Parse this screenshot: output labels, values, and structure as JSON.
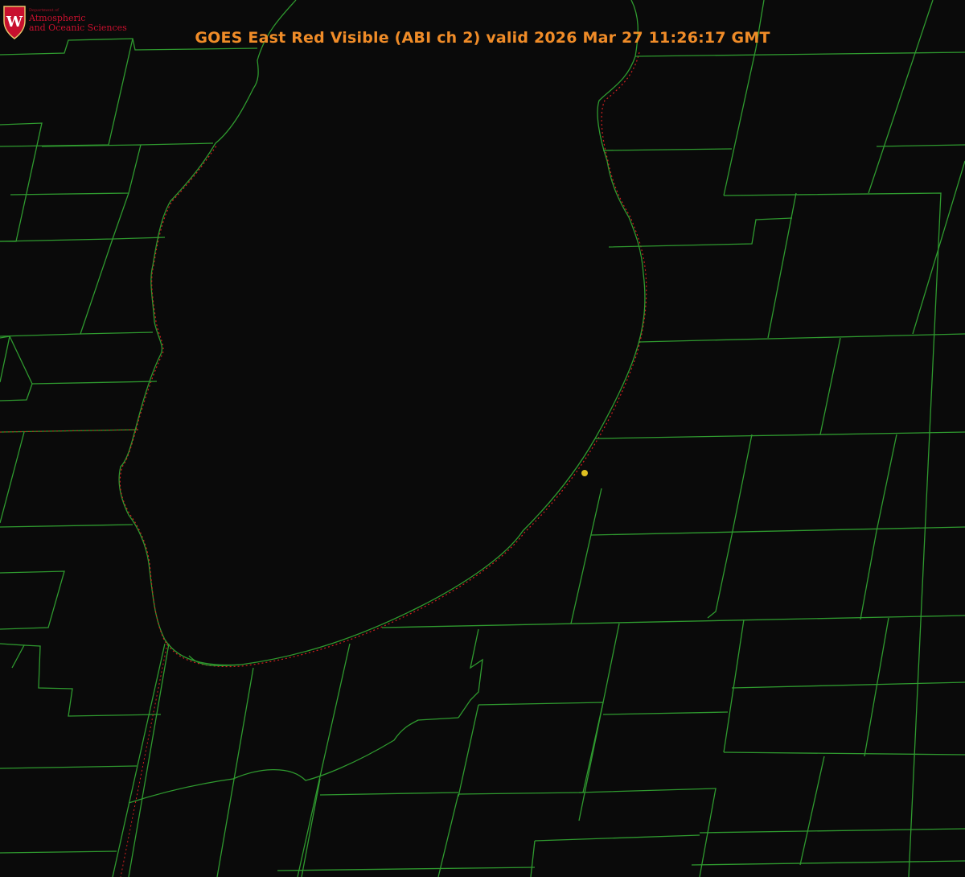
{
  "title": "GOES East Red Visible (ABI ch 2) valid 2026 Mar 27 11:26:17 GMT",
  "logo": {
    "dept": "Department of",
    "line1": "Atmospheric",
    "line2": "and Oceanic Sciences",
    "crest_letter": "W",
    "crest_icon": "uw-crest-icon"
  },
  "colors": {
    "background": "#0a0a0a",
    "county_lines": "#2f9a2f",
    "coastline_dotted": "#d02020",
    "title": "#f08c28",
    "marker": "#e0c020",
    "logo_red": "#c8102e"
  }
}
